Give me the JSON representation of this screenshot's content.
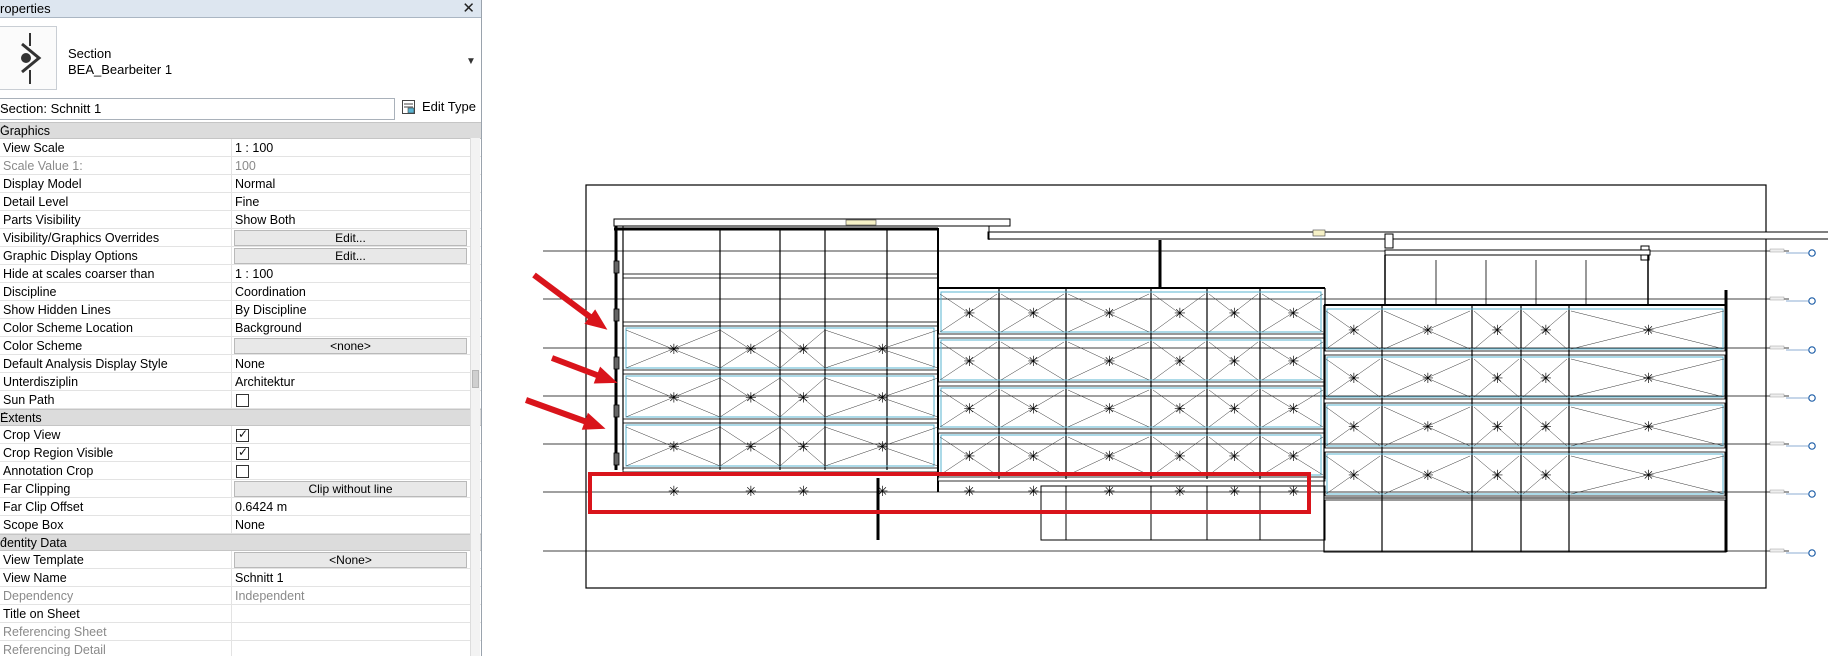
{
  "panel": {
    "title": "roperties",
    "close": "✕",
    "type_category": "Section",
    "type_name": "BEA_Bearbeiter 1",
    "instance_selector": "Section: Schnitt 1",
    "edit_type": "Edit Type",
    "groups": {
      "graphics": "Graphics",
      "extents": "Extents",
      "identity": "dentity Data"
    },
    "rows": {
      "view_scale": {
        "name": "View Scale",
        "value": "1 : 100"
      },
      "scale_value": {
        "name": "Scale Value    1:",
        "value": "100"
      },
      "display_model": {
        "name": "Display Model",
        "value": "Normal"
      },
      "detail_level": {
        "name": "Detail Level",
        "value": "Fine"
      },
      "parts_visibility": {
        "name": "Parts Visibility",
        "value": "Show Both"
      },
      "vg_overrides": {
        "name": "Visibility/Graphics Overrides",
        "value": "Edit..."
      },
      "graphic_display": {
        "name": "Graphic Display Options",
        "value": "Edit..."
      },
      "hide_scales": {
        "name": "Hide at scales coarser than",
        "value": "1 : 100"
      },
      "discipline": {
        "name": "Discipline",
        "value": "Coordination"
      },
      "hidden_lines": {
        "name": "Show Hidden Lines",
        "value": "By Discipline"
      },
      "color_scheme_location": {
        "name": "Color Scheme Location",
        "value": "Background"
      },
      "color_scheme": {
        "name": "Color Scheme",
        "value": "<none>"
      },
      "analysis_style": {
        "name": "Default Analysis Display Style",
        "value": "None"
      },
      "unterdisziplin": {
        "name": "Unterdisziplin",
        "value": "Architektur"
      },
      "sun_path": {
        "name": "Sun Path",
        "checked": false
      },
      "crop_view": {
        "name": "Crop View",
        "checked": true
      },
      "crop_region_visible": {
        "name": "Crop Region Visible",
        "checked": true
      },
      "annotation_crop": {
        "name": "Annotation Crop",
        "checked": false
      },
      "far_clipping": {
        "name": "Far Clipping",
        "value": "Clip without line"
      },
      "far_clip_offset": {
        "name": "Far Clip Offset",
        "value": "0.6424 m"
      },
      "scope_box": {
        "name": "Scope Box",
        "value": "None"
      },
      "view_template": {
        "name": "View Template",
        "value": "<None>"
      },
      "view_name": {
        "name": "View Name",
        "value": "Schnitt 1"
      },
      "dependency": {
        "name": "Dependency",
        "value": "Independent"
      },
      "title_on_sheet": {
        "name": "Title on Sheet",
        "value": ""
      },
      "ref_sheet": {
        "name": "Referencing Sheet",
        "value": ""
      },
      "ref_detail": {
        "name": "Referencing Detail",
        "value": ""
      }
    }
  },
  "colors": {
    "highlight": "#d9141b",
    "glazing": "#5ab4d2",
    "header": "#dcdcdc"
  }
}
